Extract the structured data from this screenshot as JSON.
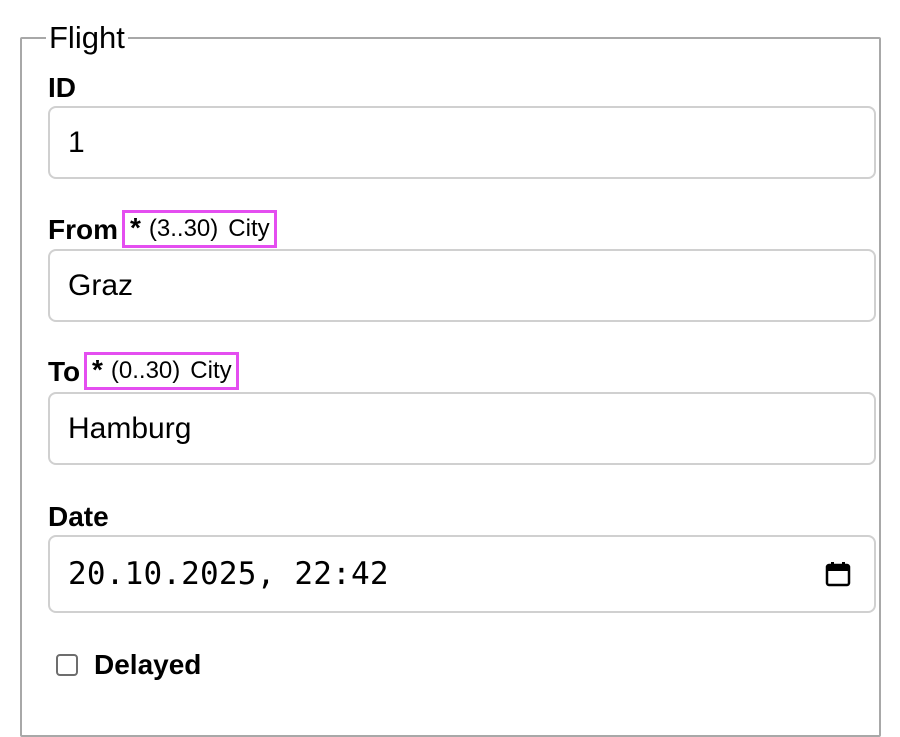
{
  "form": {
    "legend": "Flight",
    "id": {
      "label": "ID",
      "value": "1"
    },
    "from": {
      "label": "From",
      "required_mark": "*",
      "length_hint": "(3..30)",
      "type_hint": "City",
      "value": "Graz"
    },
    "to": {
      "label": "To",
      "required_mark": "*",
      "length_hint": "(0..30)",
      "type_hint": "City",
      "value": "Hamburg"
    },
    "date": {
      "label": "Date",
      "value": "20.10.2025, 22:42",
      "icon": "calendar-icon"
    },
    "delayed": {
      "label": "Delayed",
      "checked": false
    }
  },
  "colors": {
    "hint_highlight": "#e44ef0",
    "fieldset_border": "#a8a8a8",
    "input_border": "#d0d0d0"
  }
}
